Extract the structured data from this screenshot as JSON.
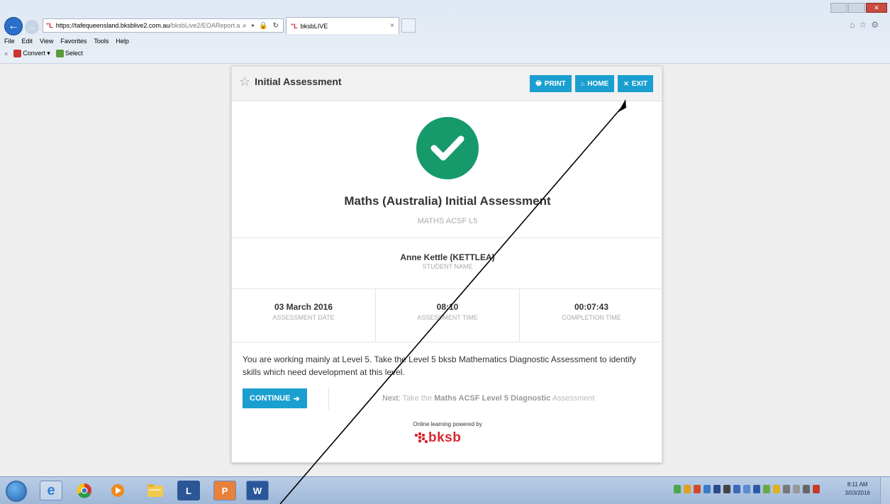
{
  "browser": {
    "url_host": "https://tafequeensland.bksblive2.com.au",
    "url_path": "/bksbLive2/EOAReport.a",
    "address_icons": "⌕ ▾ 🔒 ↻",
    "tab_title": "bksbLIVE",
    "tab_favicon": "ᴴ",
    "tab_close": "×",
    "menu": [
      "File",
      "Edit",
      "View",
      "Favorites",
      "Tools",
      "Help"
    ],
    "command_bar": {
      "close": "×",
      "convert": "Convert",
      "convert_caret": "▾",
      "select": "Select"
    }
  },
  "card": {
    "header_title": "Initial Assessment",
    "buttons": {
      "print": "PRINT",
      "home": "HOME",
      "exit": "EXIT"
    },
    "assessment_title": "Maths (Australia) Initial Assessment",
    "assessment_subtitle": "MATHS ACSF L5",
    "student": {
      "name": "Anne Kettle (KETTLEA)",
      "label": "STUDENT NAME"
    },
    "stats": [
      {
        "value": "03 March 2016",
        "label": "ASSESSMENT DATE"
      },
      {
        "value": "08:10",
        "label": "ASSESSMENT TIME"
      },
      {
        "value": "00:07:43",
        "label": "COMPLETION TIME"
      }
    ],
    "message": "You are working mainly at Level 5. Take the Level 5 bksb Mathematics Diagnostic Assessment to identify skills which need development at this level.",
    "continue_label": "CONTINUE",
    "next": {
      "prefix": "Next:",
      "text1": "Take the",
      "highlight": "Maths ACSF Level 5 Diagnostic",
      "text2": "Assessment"
    },
    "powered_by": "Online learning powered by",
    "logo_text": "bksb"
  },
  "taskbar": {
    "clock_time": "8:11 AM",
    "clock_date": "3/03/2016"
  },
  "colors": {
    "accent": "#1a9fd0",
    "success": "#169a6b",
    "brand": "#d9262e"
  }
}
